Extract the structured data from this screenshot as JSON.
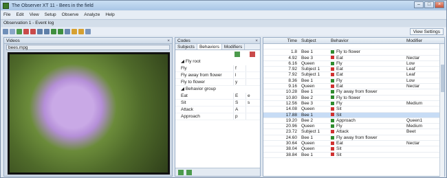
{
  "window": {
    "title": "The Observer XT 11 - Bees in the field"
  },
  "menu": [
    "File",
    "Edit",
    "View",
    "Setup",
    "Observe",
    "Analyze",
    "Help"
  ],
  "doc": {
    "tab": "Observation 1 - Event log"
  },
  "toolbar": {
    "view_settings": "View Settings"
  },
  "videos": {
    "title": "Videos",
    "file": "bees.mpg"
  },
  "codes": {
    "title": "Codes",
    "tabs": [
      "Subjects",
      "Behaviors",
      "Modifiers"
    ],
    "groups": [
      {
        "name": "Fly root",
        "items": [
          {
            "name": "Fly",
            "key": "f",
            "key2": ""
          },
          {
            "name": "Fly away from flower",
            "key": "l",
            "key2": ""
          },
          {
            "name": "Fly to flower",
            "key": "y",
            "key2": ""
          }
        ]
      },
      {
        "name": "Behavior group",
        "items": [
          {
            "name": "Eat",
            "key": "E",
            "key2": "e"
          },
          {
            "name": "Sit",
            "key": "S",
            "key2": "s"
          },
          {
            "name": "Attack",
            "key": "A",
            "key2": ""
          },
          {
            "name": "Approach",
            "key": "p",
            "key2": ""
          }
        ]
      }
    ]
  },
  "events": {
    "columns": [
      "Time",
      "Subject",
      "Behavior",
      "Modifier"
    ],
    "rows": [
      {
        "time": "",
        "subject": "",
        "behavior": "",
        "modifier": "",
        "icon": ""
      },
      {
        "time": "1.8",
        "subject": "Bee 1",
        "behavior": "Fly to flower",
        "modifier": "",
        "icon": "#2e8b2e"
      },
      {
        "time": "4.92",
        "subject": "Bee 3",
        "behavior": "Eat",
        "modifier": "Nectar",
        "icon": "#d03030"
      },
      {
        "time": "6.16",
        "subject": "Queen",
        "behavior": "Fly",
        "modifier": "Low",
        "icon": "#2e8b2e"
      },
      {
        "time": "7.92",
        "subject": "Subject 1",
        "behavior": "Eat",
        "modifier": "Leaf",
        "icon": "#d03030"
      },
      {
        "time": "7.92",
        "subject": "Subject 1",
        "behavior": "Eat",
        "modifier": "Leaf",
        "icon": "#d03030"
      },
      {
        "time": "8.36",
        "subject": "Bee 1",
        "behavior": "Fly",
        "modifier": "Low",
        "icon": "#2e8b2e"
      },
      {
        "time": "9.16",
        "subject": "Queen",
        "behavior": "Eat",
        "modifier": "Nectar",
        "icon": "#d03030"
      },
      {
        "time": "10.28",
        "subject": "Bee 1",
        "behavior": "Fly away from flower",
        "modifier": "",
        "icon": "#2e8b2e"
      },
      {
        "time": "10.80",
        "subject": "Bee 2",
        "behavior": "Fly to flower",
        "modifier": "",
        "icon": "#2e8b2e"
      },
      {
        "time": "12.56",
        "subject": "Bee 3",
        "behavior": "Fly",
        "modifier": "Medium",
        "icon": "#2e8b2e"
      },
      {
        "time": "14.08",
        "subject": "Queen",
        "behavior": "Sit",
        "modifier": "",
        "icon": "#d03030"
      },
      {
        "time": "17.88",
        "subject": "Bee 1",
        "behavior": "Sit",
        "modifier": "",
        "icon": "#d03030",
        "sel": true
      },
      {
        "time": "19.20",
        "subject": "Bee 2",
        "behavior": "Approach",
        "modifier": "Queen1",
        "icon": "#2e8b2e"
      },
      {
        "time": "20.96",
        "subject": "Queen",
        "behavior": "Fly",
        "modifier": "Medium",
        "icon": "#2e8b2e"
      },
      {
        "time": "23.72",
        "subject": "Subject 1",
        "behavior": "Attack",
        "modifier": "Beet",
        "icon": "#d03030"
      },
      {
        "time": "24.60",
        "subject": "Bee 1",
        "behavior": "Fly away from flower",
        "modifier": "",
        "icon": "#2e8b2e"
      },
      {
        "time": "30.64",
        "subject": "Queen",
        "behavior": "Eat",
        "modifier": "Nectar",
        "icon": "#d03030"
      },
      {
        "time": "38.04",
        "subject": "Queen",
        "behavior": "Sit",
        "modifier": "",
        "icon": "#d03030"
      },
      {
        "time": "38.84",
        "subject": "Bee 1",
        "behavior": "Sit",
        "modifier": "",
        "icon": "#d03030"
      }
    ]
  }
}
